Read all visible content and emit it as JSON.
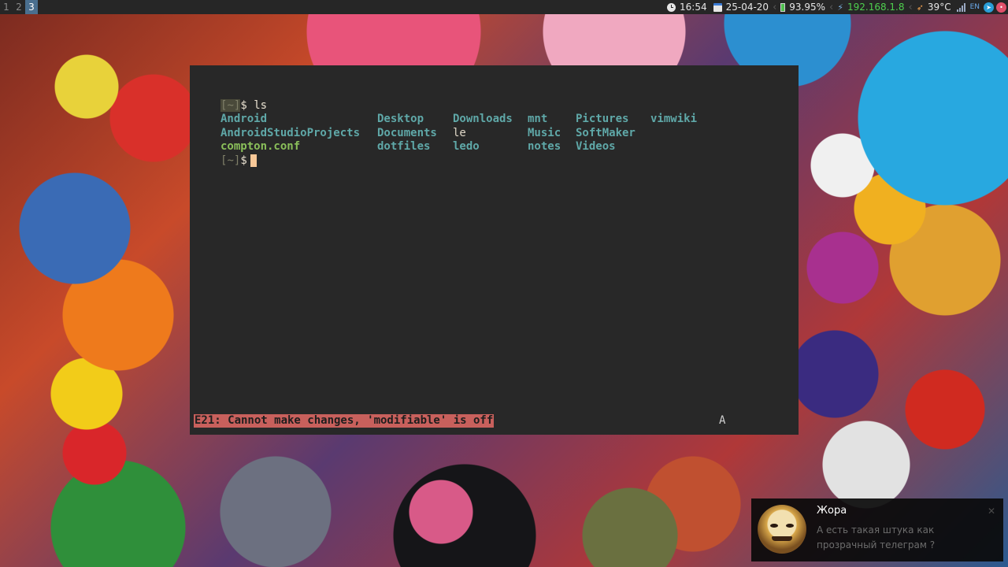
{
  "topbar": {
    "workspaces": [
      {
        "label": "1",
        "active": false
      },
      {
        "label": "2",
        "active": false
      },
      {
        "label": "3",
        "active": true
      }
    ],
    "clock": "16:54",
    "date": "25-04-20",
    "battery": "93.95%",
    "ip": "192.168.1.8",
    "temperature": "39°C",
    "layout": "EN",
    "colors": {
      "ip": "#4ecf4e",
      "active_workspace": "#4a6f8f"
    }
  },
  "terminal": {
    "prompt_tilde": "~",
    "prompt_dollar": "$",
    "command": "ls",
    "listing": [
      [
        {
          "name": "Android",
          "type": "dir"
        },
        {
          "name": "Desktop",
          "type": "dir"
        },
        {
          "name": "Downloads",
          "type": "dir"
        },
        {
          "name": "mnt",
          "type": "dir"
        },
        {
          "name": "Pictures",
          "type": "dir"
        },
        {
          "name": "vimwiki",
          "type": "dir"
        }
      ],
      [
        {
          "name": "AndroidStudioProjects",
          "type": "dir"
        },
        {
          "name": "Documents",
          "type": "dir"
        },
        {
          "name": "le",
          "type": "file"
        },
        {
          "name": "Music",
          "type": "dir"
        },
        {
          "name": "SoftMaker",
          "type": "dir"
        }
      ],
      [
        {
          "name": "compton.conf",
          "type": "conf"
        },
        {
          "name": "dotfiles",
          "type": "dir"
        },
        {
          "name": "ledo",
          "type": "dir"
        },
        {
          "name": "notes",
          "type": "dir"
        },
        {
          "name": "Videos",
          "type": "dir"
        }
      ]
    ],
    "error_message": "E21: Cannot make changes, 'modifiable' is off",
    "mode_indicator": "A"
  },
  "notification": {
    "sender": "Жора",
    "message": "А есть такая штука как прозрачный телеграм ?",
    "close_glyph": "✕"
  }
}
